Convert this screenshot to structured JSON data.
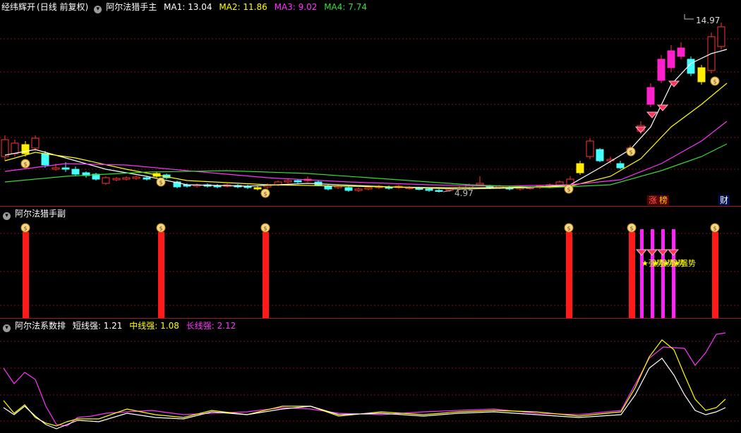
{
  "main": {
    "stock_name": "经纬辉开",
    "period_label": "(日线 前复权)",
    "indicator_name": "阿尔法猎手主",
    "ma": [
      {
        "label": "MA1:",
        "value": "13.04",
        "color": "#ffffff"
      },
      {
        "label": "MA2:",
        "value": "11.86",
        "color": "#ffff00"
      },
      {
        "label": "MA3:",
        "value": "9.02",
        "color": "#ff33ff"
      },
      {
        "label": "MA4:",
        "value": "7.74",
        "color": "#33dd33"
      }
    ],
    "high_label": "14.97",
    "low_label": "4.97",
    "tag_zhang": "涨",
    "tag_bang": "榜",
    "tag_cai": "财"
  },
  "sub1": {
    "indicator_name": "阿尔法猎手副",
    "signal_text": "★强势",
    "bar_color": "#ff1a1a",
    "short_bar_color": "#ff22ff"
  },
  "sub2": {
    "indicator_name": "阿尔法系数排",
    "lines": [
      {
        "label": "短线强:",
        "value": "1.21",
        "color": "#ffffff"
      },
      {
        "label": "中线强:",
        "value": "1.08",
        "color": "#ffff00"
      },
      {
        "label": "长线强:",
        "value": "2.12",
        "color": "#ff33ff"
      }
    ]
  },
  "colors": {
    "up": "#ff3333",
    "down": "#44ffff",
    "grid": "#8a1a1a"
  }
}
